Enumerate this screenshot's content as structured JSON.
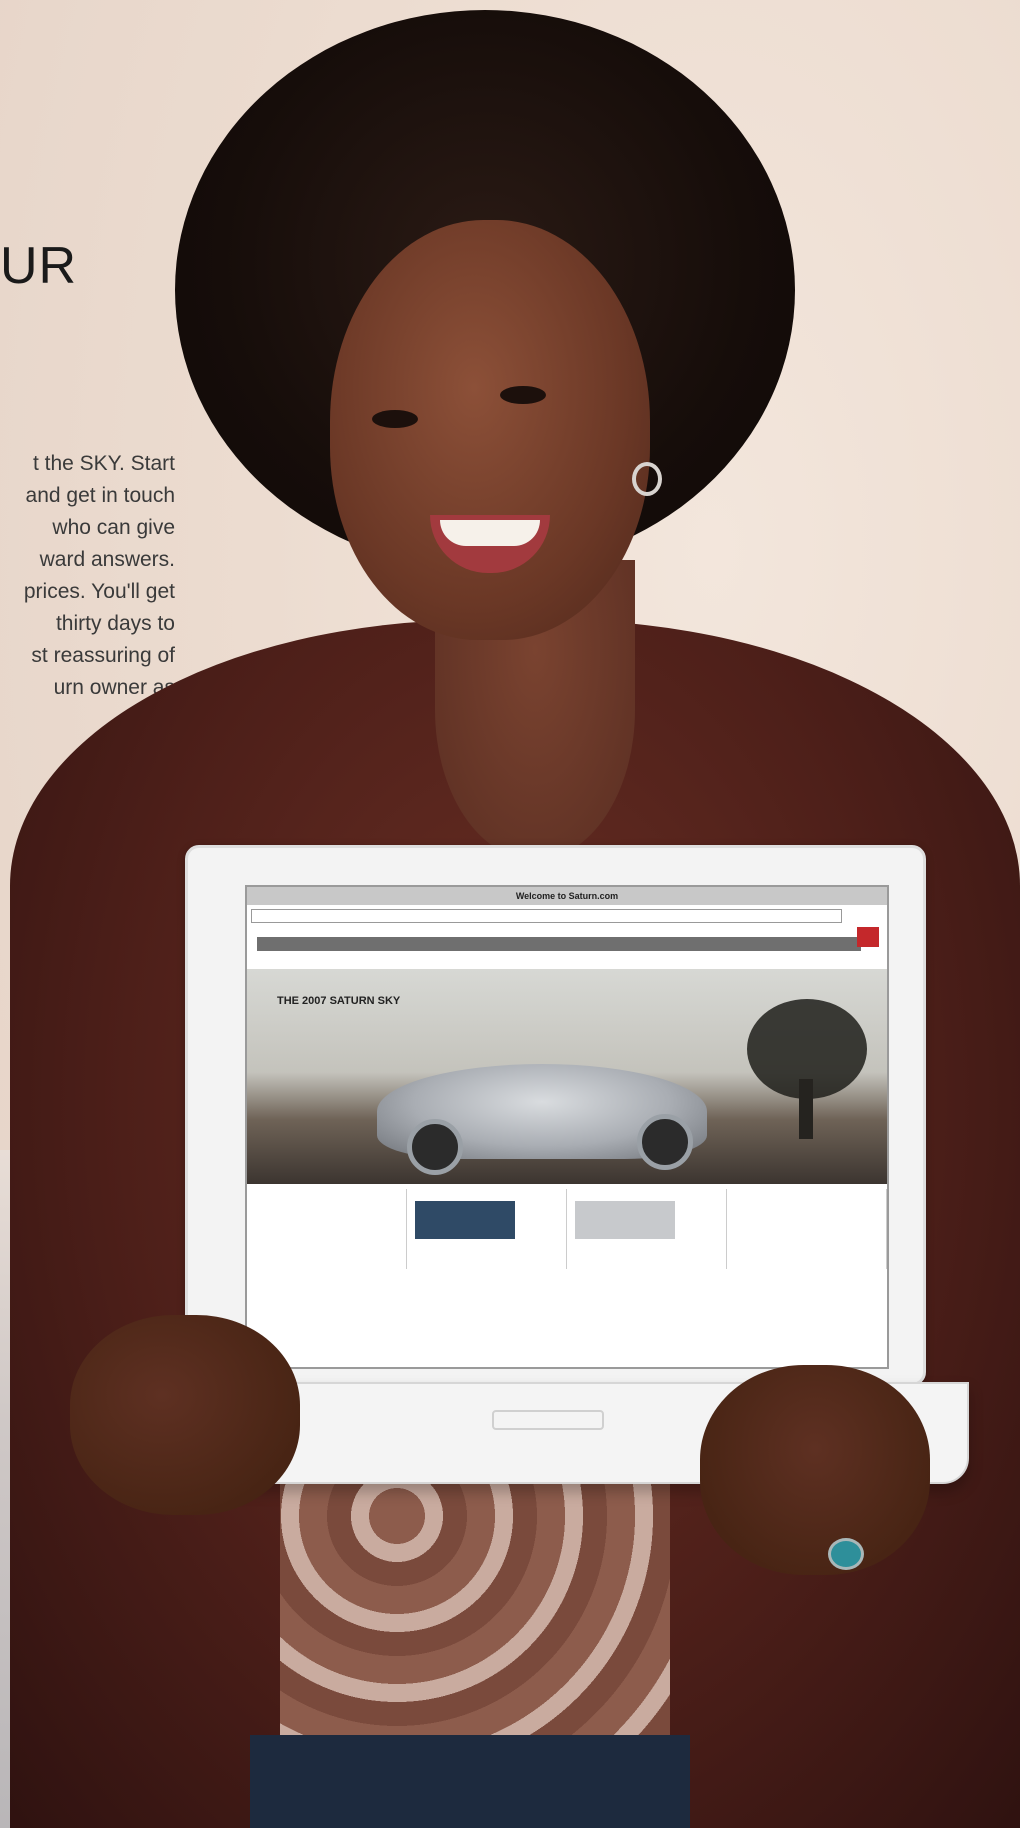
{
  "ad": {
    "headline_fragment": "UR",
    "copy_lines": [
      "t the SKY. Start",
      "and get in touch",
      "who can give",
      "ward answers.",
      "prices. You'll get",
      "thirty days to",
      "st reassuring of",
      "urn owner as"
    ]
  },
  "laptop_screen": {
    "window_title": "Welcome to Saturn.com",
    "hero_title": "THE 2007 SATURN SKY"
  },
  "colors": {
    "background": "#ecdcd0",
    "jacket": "#4d1f19",
    "laptop": "#f3f3f3",
    "saturn_red": "#c4282b"
  }
}
